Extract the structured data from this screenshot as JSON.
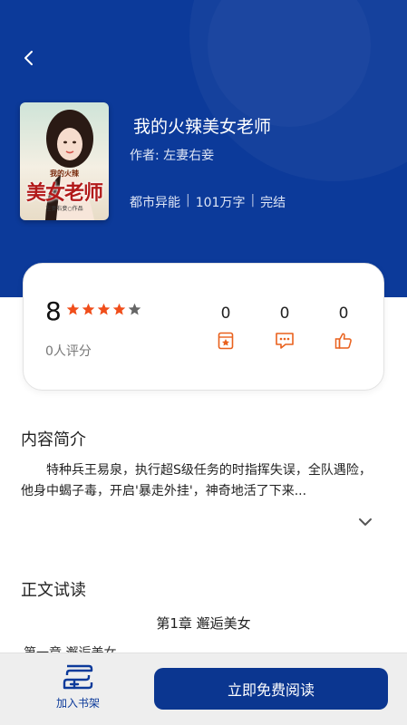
{
  "book": {
    "title": "我的火辣美女老师",
    "author_line": "作者: 左妻右妾",
    "genre": "都市异能",
    "word_count": "101万字",
    "status": "完结",
    "cover": {
      "title_text": "美女老师",
      "subtitle_text": "我的火辣",
      "author_text": "左妻右妾○作品"
    }
  },
  "rating": {
    "score": "8",
    "stars_filled": 4,
    "stars_total": 5,
    "count_text": "0人评分",
    "stats": [
      {
        "name": "ticket",
        "value": "0",
        "icon": "ticket-icon"
      },
      {
        "name": "comment",
        "value": "0",
        "icon": "comment-icon"
      },
      {
        "name": "like",
        "value": "0",
        "icon": "thumbs-up-icon"
      }
    ]
  },
  "intro": {
    "heading": "内容简介",
    "text": "特种兵王易泉，执行超S级任务的时指挥失误，全队遇险，他身中蝎子毒，开启'暴走外挂'，神奇地活了下来..."
  },
  "preview": {
    "heading": "正文试读",
    "chapter_title": "第1章 邂逅美女",
    "chapter_text": "第一章 邂逅美女"
  },
  "bottom": {
    "shelf_label": "加入书架",
    "read_label": "立即免费阅读"
  },
  "colors": {
    "primary": "#0c3a9a",
    "star": "#f04e1b",
    "icon_accent": "#e9611d"
  }
}
